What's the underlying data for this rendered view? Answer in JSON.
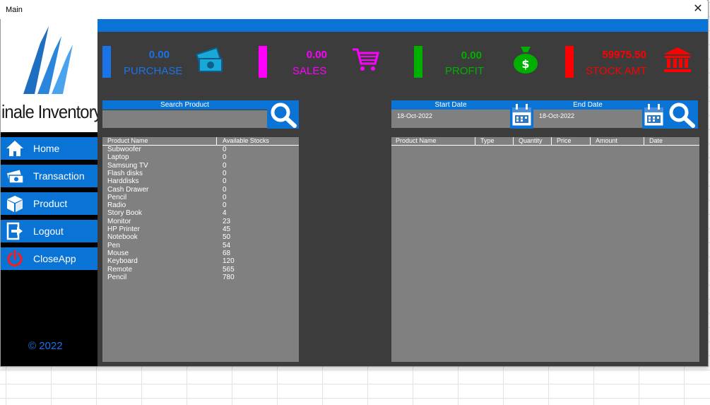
{
  "window": {
    "title": "Main",
    "close_label": "✕"
  },
  "logo": {
    "text": "inale Inventory"
  },
  "sidebar": {
    "items": [
      {
        "label": "Home",
        "icon": "home-icon"
      },
      {
        "label": "Transaction",
        "icon": "money-transfer-icon"
      },
      {
        "label": "Product",
        "icon": "box-icon"
      },
      {
        "label": "Logout",
        "icon": "logout-icon"
      },
      {
        "label": "CloseApp",
        "icon": "power-icon"
      }
    ],
    "copyright": "© 2022"
  },
  "stats": {
    "purchase": {
      "value": "0.00",
      "label": "PURCHASE",
      "color": "#1a73e8",
      "icon": "cash-icon"
    },
    "sales": {
      "value": "0.00",
      "label": "SALES",
      "color": "#ff00ff",
      "icon": "cart-icon"
    },
    "profit": {
      "value": "0.00",
      "label": "PROFIT",
      "color": "#00b000",
      "icon": "money-bag-icon"
    },
    "stock": {
      "value": "59975.50",
      "label": "STOCK AMT",
      "color": "#ff0000",
      "icon": "bank-icon"
    }
  },
  "search": {
    "header": "Search Product",
    "value": ""
  },
  "dates": {
    "start_header": "Start Date",
    "start_value": "18-Oct-2022",
    "end_header": "End Date",
    "end_value": "18-Oct-2022"
  },
  "product_list": {
    "columns": [
      "Product Name",
      "Available Stocks"
    ],
    "rows": [
      [
        "Subwoofer",
        "0"
      ],
      [
        "Laptop",
        "0"
      ],
      [
        "Samsung TV",
        "0"
      ],
      [
        "Flash disks",
        "0"
      ],
      [
        "Harddisks",
        "0"
      ],
      [
        "Cash Drawer",
        "0"
      ],
      [
        "Pencil",
        "0"
      ],
      [
        "Radio",
        "0"
      ],
      [
        "Story Book",
        "4"
      ],
      [
        "Monitor",
        "23"
      ],
      [
        "HP Printer",
        "45"
      ],
      [
        "Notebook",
        "50"
      ],
      [
        "Pen",
        "54"
      ],
      [
        "Mouse",
        "68"
      ],
      [
        "Keyboard",
        "120"
      ],
      [
        "Remote",
        "565"
      ],
      [
        "Pencil",
        "780"
      ]
    ]
  },
  "transactions": {
    "columns": [
      "Product Name",
      "Type",
      "Quantity",
      "Price",
      "Amount",
      "Date"
    ]
  }
}
